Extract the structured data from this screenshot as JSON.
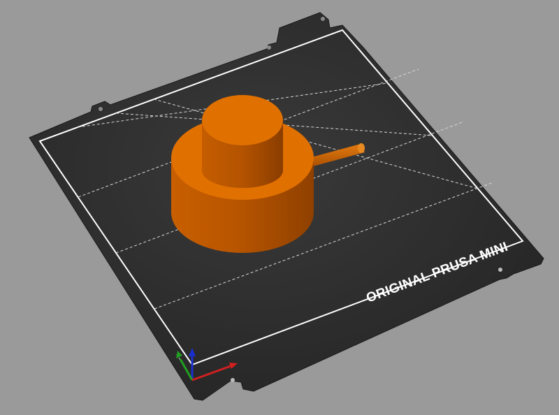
{
  "viewport": {
    "background": "#9a9a9a"
  },
  "bed": {
    "printer_name": "ORIGINAL PRUSA MINI",
    "plate_color": "#2a2a2a",
    "outline_color": "#ffffff",
    "grid_color": "#d8d8d8",
    "grid_divisions": 4
  },
  "model": {
    "color": "#e07000",
    "shape": "stepped cylinder with side rod"
  },
  "axes": {
    "x": {
      "label": "X",
      "color": "#d02020"
    },
    "y": {
      "label": "Y",
      "color": "#20a020"
    },
    "z": {
      "label": "Z",
      "color": "#1a2fd0"
    }
  }
}
